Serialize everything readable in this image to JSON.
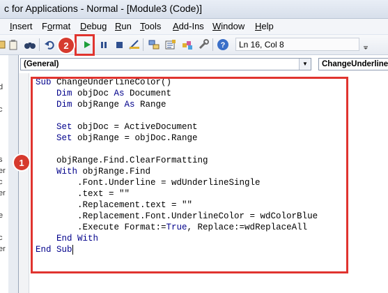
{
  "window": {
    "title": "c for Applications - Normal - [Module3 (Code)]"
  },
  "menu": {
    "items": [
      {
        "pre": "",
        "u": "I",
        "post": "nsert"
      },
      {
        "pre": "F",
        "u": "o",
        "post": "rmat"
      },
      {
        "pre": "",
        "u": "D",
        "post": "ebug"
      },
      {
        "pre": "",
        "u": "R",
        "post": "un"
      },
      {
        "pre": "",
        "u": "T",
        "post": "ools"
      },
      {
        "pre": "",
        "u": "A",
        "post": "dd-Ins"
      },
      {
        "pre": "",
        "u": "W",
        "post": "indow"
      },
      {
        "pre": "",
        "u": "H",
        "post": "elp"
      }
    ]
  },
  "toolbar": {
    "status": "Ln 16, Col 8",
    "icons": [
      "binoculars-icon",
      "undo-icon",
      "run-icon",
      "break-icon",
      "reset-icon",
      "design-mode-icon",
      "project-explorer-icon",
      "properties-icon",
      "object-browser-icon",
      "toolbox-icon",
      "help-icon"
    ]
  },
  "combos": {
    "object": "(General)",
    "procedure": "ChangeUnderlineColor"
  },
  "left_pane": {
    "fragments": [
      "l",
      "d",
      "l",
      "c",
      "s",
      "er",
      "c",
      "er",
      "e",
      "l",
      "c",
      "er"
    ]
  },
  "code": {
    "lines": [
      [
        {
          "t": "Sub ",
          "k": true
        },
        {
          "t": "ChangeUnderlineColor()",
          "k": false
        }
      ],
      [
        {
          "t": "    Dim ",
          "k": true
        },
        {
          "t": "objDoc ",
          "k": false
        },
        {
          "t": "As ",
          "k": true
        },
        {
          "t": "Document",
          "k": false
        }
      ],
      [
        {
          "t": "    Dim ",
          "k": true
        },
        {
          "t": "objRange ",
          "k": false
        },
        {
          "t": "As ",
          "k": true
        },
        {
          "t": "Range",
          "k": false
        }
      ],
      [
        {
          "t": "",
          "k": false
        }
      ],
      [
        {
          "t": "    Set ",
          "k": true
        },
        {
          "t": "objDoc = ActiveDocument",
          "k": false
        }
      ],
      [
        {
          "t": "    Set ",
          "k": true
        },
        {
          "t": "objRange = objDoc.Range",
          "k": false
        }
      ],
      [
        {
          "t": "",
          "k": false
        }
      ],
      [
        {
          "t": "    objRange.Find.ClearFormatting",
          "k": false
        }
      ],
      [
        {
          "t": "    With ",
          "k": true
        },
        {
          "t": "objRange.Find",
          "k": false
        }
      ],
      [
        {
          "t": "        .Font.Underline = wdUnderlineSingle",
          "k": false
        }
      ],
      [
        {
          "t": "        .text = \"\"",
          "k": false
        }
      ],
      [
        {
          "t": "        .Replacement.text = \"\"",
          "k": false
        }
      ],
      [
        {
          "t": "        .Replacement.Font.UnderlineColor = wdColorBlue",
          "k": false
        }
      ],
      [
        {
          "t": "        .Execute Format:=",
          "k": false
        },
        {
          "t": "True",
          "k": true
        },
        {
          "t": ", Replace:=wdReplaceAll",
          "k": false
        }
      ],
      [
        {
          "t": "    End With",
          "k": true
        }
      ],
      [
        {
          "t": "End Sub",
          "k": true
        }
      ]
    ]
  },
  "annotations": {
    "badge1": "1",
    "badge2": "2"
  },
  "colors": {
    "highlight": "#e0342f",
    "badge": "#d63a2e",
    "keyword": "#00008b"
  }
}
